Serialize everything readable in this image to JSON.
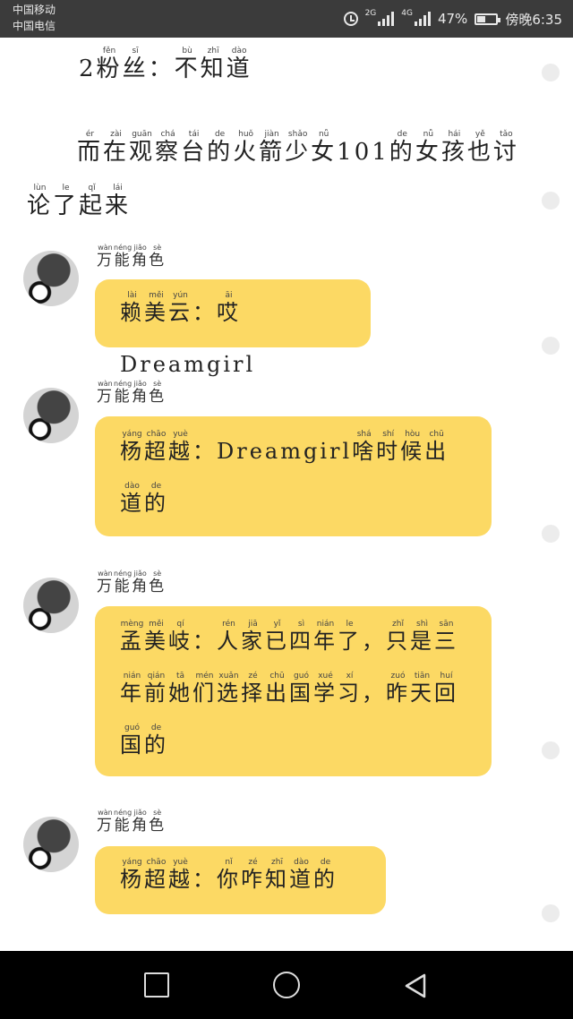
{
  "status_bar": {
    "carrier1": "中国移动",
    "carrier2": "中国电信",
    "net1": "2G",
    "net2": "4G",
    "battery": "47%",
    "time": "傍晚6:35"
  },
  "article": {
    "line1_prefix": "2",
    "line1": [
      [
        "粉",
        "fěn"
      ],
      [
        "丝",
        "sī"
      ],
      [
        "：",
        ""
      ],
      [
        "不",
        "bù"
      ],
      [
        "知",
        "zhī"
      ],
      [
        "道",
        "dào"
      ]
    ],
    "line2": [
      [
        "而",
        "ér"
      ],
      [
        "在",
        "zài"
      ],
      [
        "观",
        "guān"
      ],
      [
        "察",
        "chá"
      ],
      [
        "台",
        "tái"
      ],
      [
        "的",
        "de"
      ],
      [
        "火",
        "huǒ"
      ],
      [
        "箭",
        "jiàn"
      ],
      [
        "少",
        "shǎo"
      ],
      [
        "女",
        "nǚ"
      ],
      [
        "101",
        ""
      ],
      [
        "的",
        "de"
      ],
      [
        "女",
        "nǚ"
      ],
      [
        "孩",
        "hái"
      ],
      [
        "也",
        "yě"
      ],
      [
        "讨",
        "tǎo"
      ],
      [
        "论",
        "lùn"
      ],
      [
        "了",
        "le"
      ],
      [
        "起",
        "qǐ"
      ],
      [
        "来",
        "lái"
      ]
    ]
  },
  "messages": [
    {
      "sender": [
        [
          "万",
          "wàn"
        ],
        [
          "能",
          "néng"
        ],
        [
          "角",
          "jiǎo"
        ],
        [
          "色",
          "sè"
        ]
      ],
      "text": [
        [
          "赖",
          "lài"
        ],
        [
          "美",
          "měi"
        ],
        [
          "云",
          "yún"
        ],
        [
          "：",
          ""
        ],
        [
          "哎",
          "āi"
        ],
        [
          "Dreamgirl",
          ""
        ]
      ]
    },
    {
      "sender": [
        [
          "万",
          "wàn"
        ],
        [
          "能",
          "néng"
        ],
        [
          "角",
          "jiǎo"
        ],
        [
          "色",
          "sè"
        ]
      ],
      "text": [
        [
          "杨",
          "yáng"
        ],
        [
          "超",
          "chāo"
        ],
        [
          "越",
          "yuè"
        ],
        [
          "：",
          ""
        ],
        [
          "Dreamgirl",
          ""
        ],
        [
          "啥",
          "shá"
        ],
        [
          "时",
          "shí"
        ],
        [
          "候",
          "hòu"
        ],
        [
          "出",
          "chū"
        ],
        [
          "道",
          "dào"
        ],
        [
          "的",
          "de"
        ]
      ]
    },
    {
      "sender": [
        [
          "万",
          "wàn"
        ],
        [
          "能",
          "néng"
        ],
        [
          "角",
          "jiǎo"
        ],
        [
          "色",
          "sè"
        ]
      ],
      "text": [
        [
          "孟",
          "mèng"
        ],
        [
          "美",
          "měi"
        ],
        [
          "岐",
          "qí"
        ],
        [
          "：",
          ""
        ],
        [
          "人",
          "rén"
        ],
        [
          "家",
          "jiā"
        ],
        [
          "已",
          "yǐ"
        ],
        [
          "四",
          "sì"
        ],
        [
          "年",
          "nián"
        ],
        [
          "了",
          "le"
        ],
        [
          "，",
          ""
        ],
        [
          "只",
          "zhǐ"
        ],
        [
          "是",
          "shì"
        ],
        [
          "三",
          "sān"
        ],
        [
          "年",
          "nián"
        ],
        [
          "前",
          "qián"
        ],
        [
          "她",
          "tā"
        ],
        [
          "们",
          "mén"
        ],
        [
          "选",
          "xuǎn"
        ],
        [
          "择",
          "zé"
        ],
        [
          "出",
          "chū"
        ],
        [
          "国",
          "guó"
        ],
        [
          "学",
          "xué"
        ],
        [
          "习",
          "xí"
        ],
        [
          "，",
          ""
        ],
        [
          "昨",
          "zuó"
        ],
        [
          "天",
          "tiān"
        ],
        [
          "回",
          "huí"
        ],
        [
          "国",
          "guó"
        ],
        [
          "的",
          "de"
        ]
      ]
    },
    {
      "sender": [
        [
          "万",
          "wàn"
        ],
        [
          "能",
          "néng"
        ],
        [
          "角",
          "jiǎo"
        ],
        [
          "色",
          "sè"
        ]
      ],
      "text": [
        [
          "杨",
          "yáng"
        ],
        [
          "超",
          "chāo"
        ],
        [
          "越",
          "yuè"
        ],
        [
          "：",
          ""
        ],
        [
          "你",
          "nǐ"
        ],
        [
          "咋",
          "zé"
        ],
        [
          "知",
          "zhī"
        ],
        [
          "道",
          "dào"
        ],
        [
          "的",
          "de"
        ]
      ]
    }
  ],
  "colors": {
    "bubble": "#fcd964",
    "status_bar": "#3b3b3b",
    "nav_bar": "#000000"
  },
  "icons": [
    "alarm-icon",
    "signal-icon",
    "battery-icon",
    "square-icon",
    "circle-icon",
    "triangle-back-icon"
  ]
}
